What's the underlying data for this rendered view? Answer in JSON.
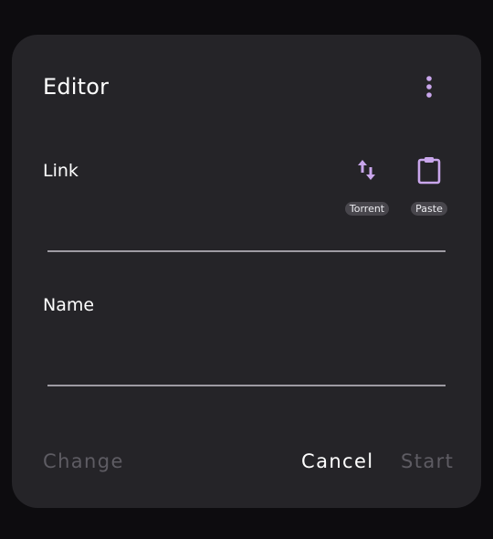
{
  "dialog": {
    "title": "Editor",
    "menu_icon": "more-vert-icon"
  },
  "link_field": {
    "label": "Link",
    "value": "",
    "actions": [
      {
        "icon": "swap-vert-icon",
        "label": "Torrent"
      },
      {
        "icon": "clipboard-icon",
        "label": "Paste"
      }
    ]
  },
  "name_field": {
    "label": "Name",
    "value": ""
  },
  "footer": {
    "change_label": "Change",
    "cancel_label": "Cancel",
    "start_label": "Start"
  },
  "colors": {
    "background": "#0d0c0f",
    "surface": "#252428",
    "accent": "#c9a6ec",
    "disabled_text": "#5e5c63",
    "underline": "#9e9ba3"
  }
}
